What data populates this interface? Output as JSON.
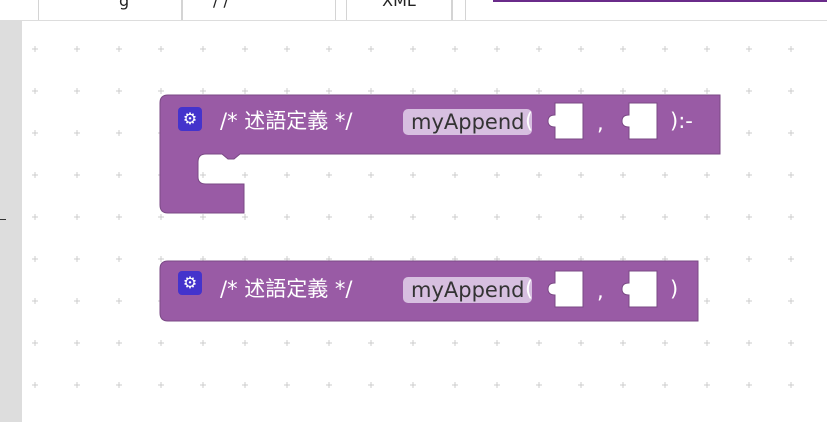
{
  "tabs": [
    {
      "label": "g"
    },
    {
      "label": "/ /"
    },
    {
      "label": "XML"
    }
  ],
  "colors": {
    "block": "#995ba5",
    "block_border": "#7a4985",
    "gear_button": "#4433cc",
    "field_bg": "#d7bfe0",
    "tab_accent": "#6a2b8a"
  },
  "blocks": [
    {
      "type": "predicate-definition-with-body",
      "comment": "/* 述語定義 */",
      "name": "myAppend",
      "open_paren": "(",
      "separator": ",",
      "close": "):-",
      "gear_icon": "gear-icon"
    },
    {
      "type": "predicate-definition",
      "comment": "/* 述語定義 */",
      "name": "myAppend",
      "open_paren": "(",
      "separator": ",",
      "close": ")",
      "gear_icon": "gear-icon"
    }
  ]
}
